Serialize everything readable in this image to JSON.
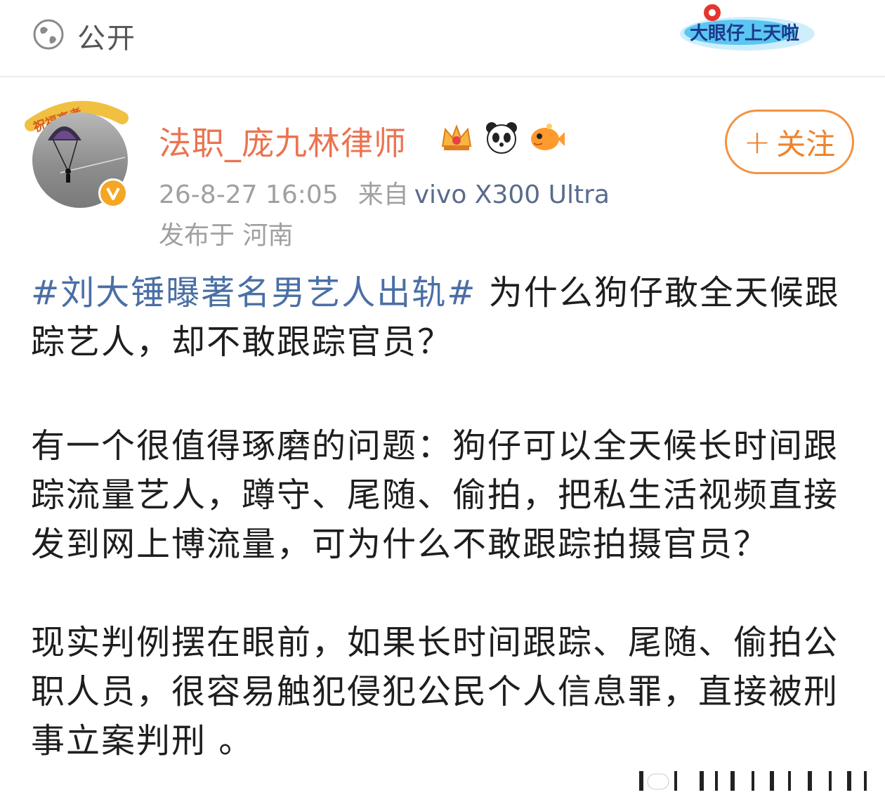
{
  "header": {
    "visibility_label": "公开",
    "visibility_icon": "globe-icon",
    "badge_text": "大眼仔上天啦"
  },
  "author": {
    "avatar_frame_text": "祝福高考",
    "name": "法职_庞九林律师",
    "badges": [
      "crown-icon",
      "panda-icon",
      "fish-icon"
    ],
    "verified_icon": "verified-v-icon",
    "timestamp": "26-8-27 16:05",
    "source_label": "来自",
    "device": "vivo X300 Ultra",
    "location": "发布于 河南"
  },
  "follow_button": {
    "plus": "+",
    "label": "关注"
  },
  "post": {
    "topic": "#刘大锤曝著名男艺人出轨#",
    "p1_rest": " 为什么狗仔敢全天候跟踪艺人，却不敢跟踪官员？",
    "p2": "有一个很值得琢磨的问题：狗仔可以全天候长时间跟踪流量艺人，蹲守、尾随、偷拍，把私生活视频直接发到网上博流量，可为什么不敢跟踪拍摄官员？",
    "p3": "现实判例摆在眼前，如果长时间跟踪、尾随、偷拍公职人员，很容易触犯侵犯公民个人信息罪，直接被刑事立案判刑 。"
  },
  "colors": {
    "username": "#eb7350",
    "topic": "#4a6fa5",
    "follow": "#f0822a",
    "meta": "#a0a0a0"
  }
}
